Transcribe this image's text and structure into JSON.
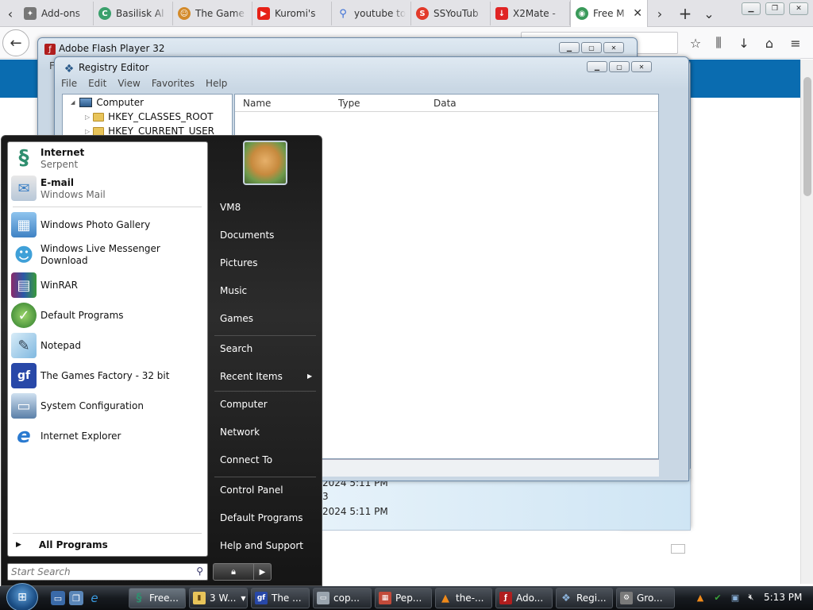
{
  "browser": {
    "tabs": [
      {
        "label": "Add-ons",
        "icon": "puzzle-icon",
        "color": "#555"
      },
      {
        "label": "Basilisk Al",
        "icon": "basilisk-icon",
        "color": "#3aa06c"
      },
      {
        "label": "The Game",
        "icon": "face-icon",
        "color": "#d38a2a"
      },
      {
        "label": "Kuromi's",
        "icon": "youtube-icon",
        "color": "#e62117"
      },
      {
        "label": "youtube to",
        "icon": "search-icon",
        "color": "#3a6fd6"
      },
      {
        "label": "SSYouTub",
        "icon": "ss-icon",
        "color": "#e23a2a"
      },
      {
        "label": "X2Mate -",
        "icon": "download-icon",
        "color": "#e02424"
      },
      {
        "label": "Free M",
        "icon": "globe-icon",
        "color": "#3a9a5a"
      }
    ],
    "new_tab_glyph": "+",
    "tab_list_glyph": "⌄",
    "scroll_right_glyph": "›",
    "scroll_left_glyph": "‹",
    "close_glyph": "✕"
  },
  "flash_window": {
    "title": "Adobe Flash Player 32",
    "menu_first": "Fi"
  },
  "registry": {
    "title": "Registry Editor",
    "menu": [
      "File",
      "Edit",
      "View",
      "Favorites",
      "Help"
    ],
    "tree": [
      {
        "label": "Computer",
        "expander": "◢",
        "level": 0
      },
      {
        "label": "HKEY_CLASSES_ROOT",
        "expander": "▷",
        "level": 1
      },
      {
        "label": "HKEY_CURRENT_USER",
        "expander": "▷",
        "level": 1
      }
    ],
    "columns": [
      "Name",
      "Type",
      "Data"
    ]
  },
  "behind_info": {
    "line1": "2024 5:11 PM",
    "line2": "3",
    "line3": "2024 5:11 PM"
  },
  "start_menu": {
    "pinned": [
      {
        "title": "Internet",
        "subtitle": "Serpent",
        "icon": "serpent-icon",
        "color": "#2f8f6f"
      },
      {
        "title": "E-mail",
        "subtitle": "Windows Mail",
        "icon": "mail-icon",
        "color": "#3b7fc4"
      }
    ],
    "recent": [
      {
        "label": "Windows Photo Gallery",
        "icon": "photo-gallery-icon",
        "color": "#4a8fd0"
      },
      {
        "label": "Windows Live Messenger Download",
        "icon": "messenger-icon",
        "color": "#3fa0d8"
      },
      {
        "label": "WinRAR",
        "icon": "winrar-icon",
        "color": "#8a2a6a"
      },
      {
        "label": "Default Programs",
        "icon": "default-programs-icon",
        "color": "#3c9a3c"
      },
      {
        "label": "Notepad",
        "icon": "notepad-icon",
        "color": "#7fb8e0"
      },
      {
        "label": "The Games Factory - 32 bit",
        "icon": "games-factory-icon",
        "color": "#2848a8"
      },
      {
        "label": "System Configuration",
        "icon": "system-config-icon",
        "color": "#5a7fa8"
      },
      {
        "label": "Internet Explorer",
        "icon": "ie-icon",
        "color": "#2a7ad0"
      }
    ],
    "all_programs": "All Programs",
    "search_placeholder": "Start Search",
    "right": {
      "user": "VM8",
      "items1": [
        "Documents",
        "Pictures",
        "Music",
        "Games"
      ],
      "items2": [
        "Search",
        "Recent Items"
      ],
      "items3": [
        "Computer",
        "Network",
        "Connect To"
      ],
      "items4": [
        "Control Panel",
        "Default Programs",
        "Help and Support"
      ],
      "recent_arrow": "▶"
    }
  },
  "taskbar": {
    "buttons": [
      {
        "label": "Free...",
        "icon": "serpent-icon",
        "color": "#2f8f6f"
      },
      {
        "label": "3 W...",
        "icon": "folder-icon",
        "color": "#e8c45a"
      },
      {
        "label": "The ...",
        "icon": "games-factory-icon",
        "color": "#2848a8"
      },
      {
        "label": "cop...",
        "icon": "window-icon",
        "color": "#9aa4ae"
      },
      {
        "label": "Pep...",
        "icon": "pepper-icon",
        "color": "#c24a3a"
      },
      {
        "label": "the-...",
        "icon": "vlc-icon",
        "color": "#f08a1a"
      },
      {
        "label": "Ado...",
        "icon": "flash-icon",
        "color": "#b01e1e"
      },
      {
        "label": "Regi...",
        "icon": "registry-icon",
        "color": "#4a7aa8"
      },
      {
        "label": "Gro...",
        "icon": "group-icon",
        "color": "#7a7a7a"
      }
    ],
    "clock": "5:13 PM"
  }
}
